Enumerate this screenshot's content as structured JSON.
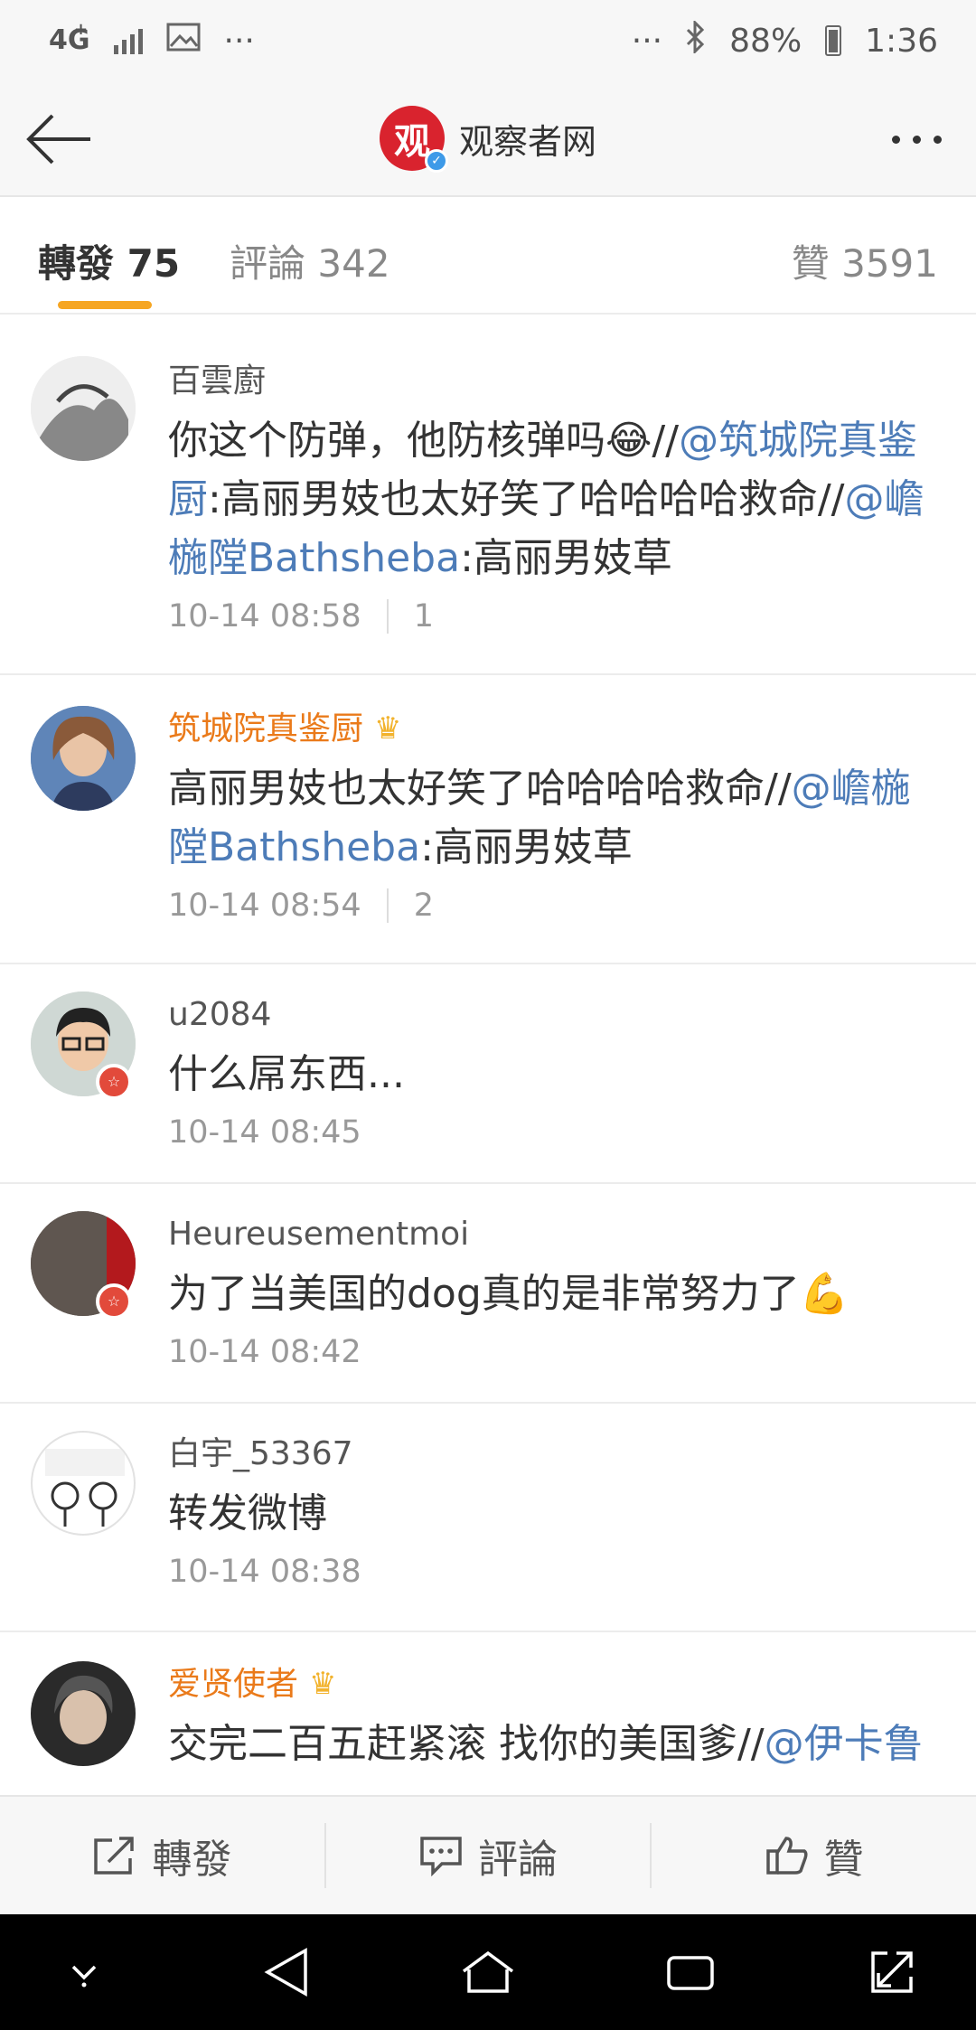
{
  "status_bar": {
    "network": "4G",
    "network_sub": "+",
    "battery_percent": "88%",
    "time": "1:36"
  },
  "header": {
    "title": "观察者网",
    "logo_glyph": "观"
  },
  "tabs": [
    {
      "label": "轉發",
      "count": "75",
      "active": true
    },
    {
      "label": "評論",
      "count": "342",
      "active": false
    },
    {
      "label": "贊",
      "count": "3591",
      "active": false
    }
  ],
  "comments": [
    {
      "username": "百雲廚",
      "vip": false,
      "text_parts": [
        {
          "t": "你这个防弹，他防核弹吗😂//",
          "mention": false
        },
        {
          "t": "@筑城院真鉴厨",
          "mention": true
        },
        {
          "t": ":高丽男妓也太好笑了哈哈哈哈救命//",
          "mention": false
        },
        {
          "t": "@嶦椸隚Bathsheba",
          "mention": true
        },
        {
          "t": ":高丽男妓草",
          "mention": false
        }
      ],
      "time": "10-14 08:58",
      "likes": "1"
    },
    {
      "username": "筑城院真鉴厨",
      "vip": true,
      "text_parts": [
        {
          "t": "高丽男妓也太好笑了哈哈哈哈救命//",
          "mention": false
        },
        {
          "t": "@嶦椸隚Bathsheba",
          "mention": true
        },
        {
          "t": ":高丽男妓草",
          "mention": false
        }
      ],
      "time": "10-14 08:54",
      "likes": "2"
    },
    {
      "username": "u2084",
      "vip": false,
      "text_parts": [
        {
          "t": "什么屌东西...",
          "mention": false
        }
      ],
      "time": "10-14 08:45",
      "likes": ""
    },
    {
      "username": "Heureusementmoi",
      "vip": false,
      "text_parts": [
        {
          "t": "为了当美国的dog真的是非常努力了💪",
          "mention": false
        }
      ],
      "time": "10-14 08:42",
      "likes": ""
    },
    {
      "username": "白宇_53367",
      "vip": false,
      "text_parts": [
        {
          "t": "转发微博",
          "mention": false
        }
      ],
      "time": "10-14 08:38",
      "likes": ""
    },
    {
      "username": "爱贤使者",
      "vip": true,
      "text_parts": [
        {
          "t": "交完二百五赶紧滚 找你的美国爹//",
          "mention": false
        },
        {
          "t": "@伊卡鲁",
          "mention": true
        }
      ],
      "time": "",
      "likes": ""
    }
  ],
  "action_bar": {
    "repost": "轉發",
    "comment": "評論",
    "like": "贊"
  },
  "colors": {
    "accent": "#f6a623",
    "mention": "#4d7cb8",
    "vip_name": "#ea7a1a",
    "brand_red": "#d9232e"
  }
}
